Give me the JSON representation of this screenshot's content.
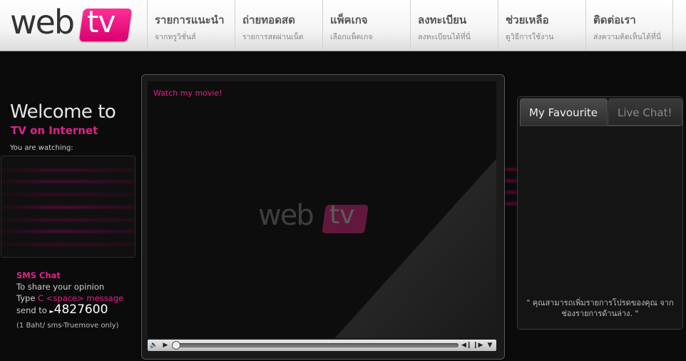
{
  "logo": {
    "web": "web",
    "tv": "tv"
  },
  "nav": [
    {
      "title": "รายการแนะนำ",
      "subtitle": "จากทรูวิชั่นส์"
    },
    {
      "title": "ถ่ายทอดสด",
      "subtitle": "รายการสดผ่านเน็ต"
    },
    {
      "title": "แพ็คเกจ",
      "subtitle": "เลือกแพ็คเกจ"
    },
    {
      "title": "ลงทะเบียน",
      "subtitle": "ลงทะเบียนได้ที่นี่"
    },
    {
      "title": "ช่วยเหลือ",
      "subtitle": "ดูวิธีการใช้งาน"
    },
    {
      "title": "ติดต่อเรา",
      "subtitle": "ส่งความคิดเห็นได้ที่นี่"
    }
  ],
  "left": {
    "welcome": "Welcome to",
    "tv_internet": "TV on Internet",
    "watching": "You are watching:"
  },
  "sms": {
    "heading": "SMS Chat",
    "line1": "To share your opinion",
    "type_prefix": "Type ",
    "type_code": "C <space> message",
    "send_to": "send to",
    "number": "4827600",
    "note": "(1 Baht/ sms-Truemove only)"
  },
  "player": {
    "label": "Watch my movie!",
    "watermark_web": "web",
    "watermark_tv": "tv",
    "icons": [
      "volume-icon",
      "play-icon",
      "prev-icon",
      "next-icon",
      "menu-down-icon"
    ],
    "seek_position": 0
  },
  "right": {
    "tab_favourite": "My Favourite",
    "tab_chat": "Live Chat!",
    "note": "\" คุณสามารถเพิ่มรายการโปรดของคุณ จากช่องรายการด้านล่าง. \""
  },
  "colors": {
    "accent": "#e0228a",
    "background": "#0b0b0b"
  }
}
